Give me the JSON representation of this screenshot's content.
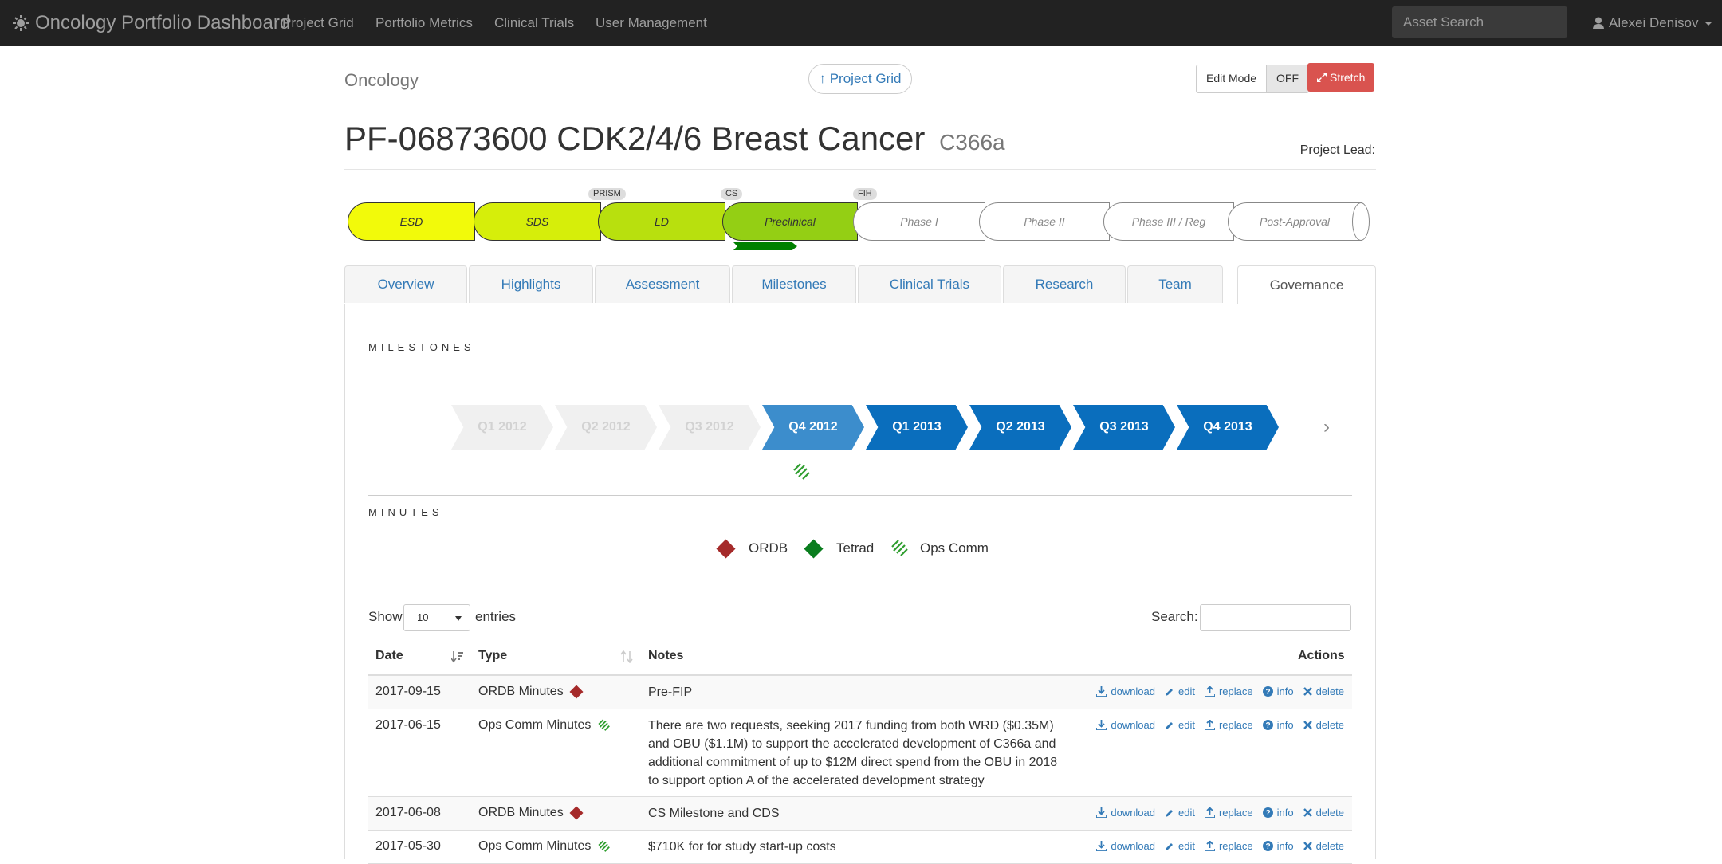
{
  "navbar": {
    "brand": "Oncology Portfolio Dashboard",
    "links": [
      "Project Grid",
      "Portfolio Metrics",
      "Clinical Trials",
      "User Management"
    ],
    "search_placeholder": "Asset Search",
    "user": "Alexei Denisov"
  },
  "header": {
    "category": "Oncology",
    "project_grid_link": "↑ Project Grid",
    "edit_mode_label": "Edit Mode",
    "edit_mode_state": "OFF",
    "stretch_label": "Stretch",
    "title": "PF-06873600 CDK2/4/6 Breast Cancer",
    "code": "C366a",
    "project_lead_label": "Project Lead:"
  },
  "pipeline": {
    "stages": [
      "ESD",
      "SDS",
      "LD",
      "Preclinical",
      "Phase I",
      "Phase II",
      "Phase III / Reg",
      "Post-Approval"
    ],
    "markers": [
      "PRISM",
      "CS",
      "FIH"
    ],
    "completed_colors": [
      "#f2fa0a",
      "#d6ee0a",
      "#b8e00e",
      "#94cf14"
    ]
  },
  "tabs": [
    "Overview",
    "Highlights",
    "Assessment",
    "Milestones",
    "Clinical Trials",
    "Research",
    "Team",
    "Governance"
  ],
  "active_tab": "Governance",
  "milestones": {
    "heading": "MILESTONES",
    "quarters": [
      "Q1 2012",
      "Q2 2012",
      "Q3 2012",
      "Q4 2012",
      "Q1 2013",
      "Q2 2013",
      "Q3 2013",
      "Q4 2013"
    ],
    "next_glyph": "›"
  },
  "minutes": {
    "heading": "MINUTES",
    "legend": [
      {
        "label": "ORDB",
        "icon": "red-diamond-icon",
        "color": "#a52a2a"
      },
      {
        "label": "Tetrad",
        "icon": "green-diamond-icon",
        "color": "#0a7d1e"
      },
      {
        "label": "Ops Comm",
        "icon": "hatched-diamond-icon",
        "color": "#2e9e2e"
      }
    ]
  },
  "table": {
    "show_label": "Show",
    "entries_value": "10",
    "entries_label": "entries",
    "search_label": "Search:",
    "headers": {
      "date": "Date",
      "type": "Type",
      "notes": "Notes",
      "actions": "Actions"
    },
    "action_labels": [
      "download",
      "edit",
      "replace",
      "info",
      "delete"
    ],
    "rows": [
      {
        "date": "2017-09-15",
        "type": "ORDB Minutes",
        "notes": "Pre-FIP"
      },
      {
        "date": "2017-06-15",
        "type": "Ops Comm Minutes",
        "notes": "There are two requests, seeking 2017 funding from both WRD ($0.35M) and OBU ($1.1M) to support the accelerated development of C366a and additional commitment of up to $12M direct spend from the OBU in 2018 to support option A of the accelerated development strategy"
      },
      {
        "date": "2017-06-08",
        "type": "ORDB Minutes",
        "notes": "CS Milestone and CDS"
      },
      {
        "date": "2017-05-30",
        "type": "Ops Comm Minutes",
        "notes": "$710K for for study start-up costs"
      }
    ]
  }
}
